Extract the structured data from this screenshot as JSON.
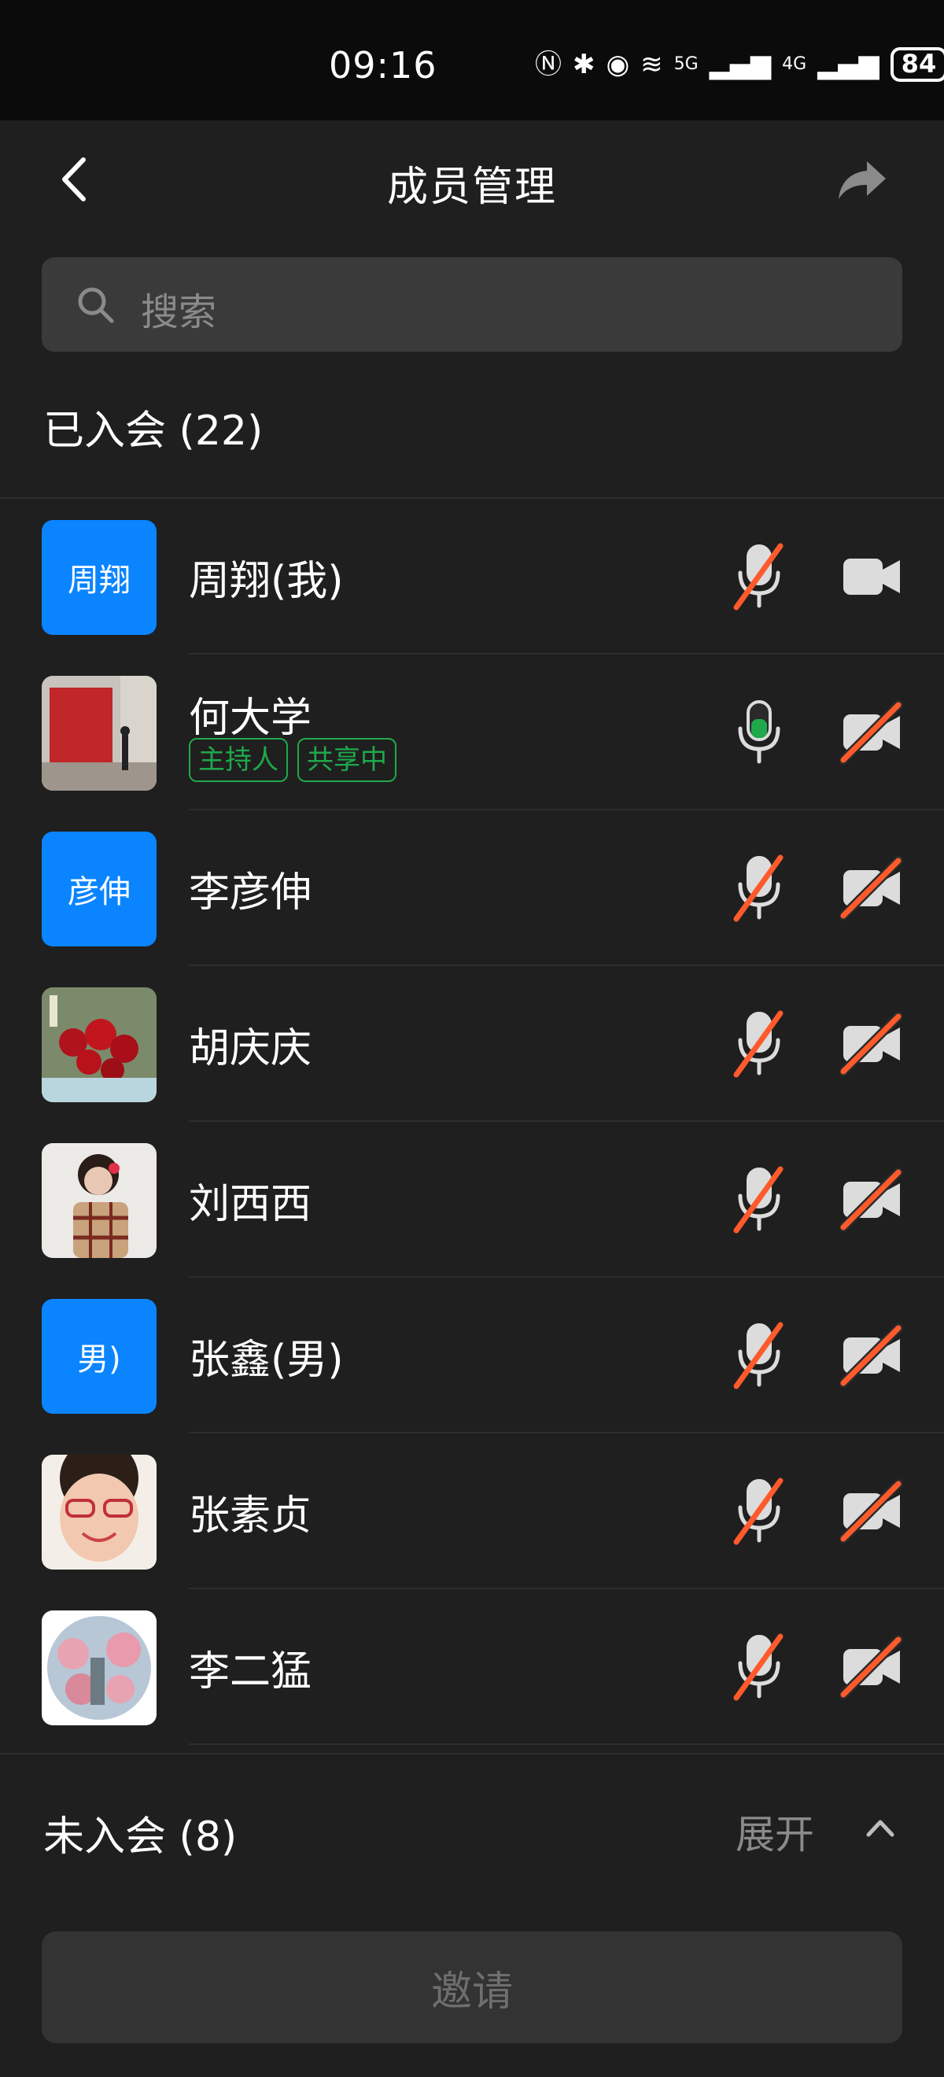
{
  "status": {
    "time": "09:16",
    "battery": "84",
    "net1": "5G",
    "net2": "4G"
  },
  "header": {
    "title": "成员管理"
  },
  "search": {
    "placeholder": "搜索"
  },
  "joined": {
    "title": "已入会 (22)"
  },
  "members": [
    {
      "name": "周翔(我)",
      "avatar_text": "周翔",
      "avatar_kind": "text",
      "tags": [],
      "mic": "muted",
      "cam": "on"
    },
    {
      "name": "何大学",
      "avatar_text": "",
      "avatar_kind": "photo-flag",
      "tags": [
        "主持人",
        "共享中"
      ],
      "mic": "on",
      "cam": "off"
    },
    {
      "name": "李彦伸",
      "avatar_text": "彦伸",
      "avatar_kind": "text",
      "tags": [],
      "mic": "muted",
      "cam": "off"
    },
    {
      "name": "胡庆庆",
      "avatar_text": "",
      "avatar_kind": "photo-roses",
      "tags": [],
      "mic": "muted",
      "cam": "off"
    },
    {
      "name": "刘西西",
      "avatar_text": "",
      "avatar_kind": "photo-girl",
      "tags": [],
      "mic": "muted",
      "cam": "off"
    },
    {
      "name": "张鑫(男)",
      "avatar_text": "男)",
      "avatar_kind": "text",
      "tags": [],
      "mic": "muted",
      "cam": "off"
    },
    {
      "name": "张素贞",
      "avatar_text": "",
      "avatar_kind": "photo-face",
      "tags": [],
      "mic": "muted",
      "cam": "off"
    },
    {
      "name": "李二猛",
      "avatar_text": "",
      "avatar_kind": "photo-blossom",
      "tags": [],
      "mic": "muted",
      "cam": "off"
    }
  ],
  "not_joined": {
    "title": "未入会 (8)",
    "expand_label": "展开"
  },
  "invite": {
    "label": "邀请"
  },
  "colors": {
    "accent_blue": "#0a84ff",
    "green": "#1fa84c",
    "mute_red": "#ff5a2b",
    "bg": "#1f1f1f"
  }
}
